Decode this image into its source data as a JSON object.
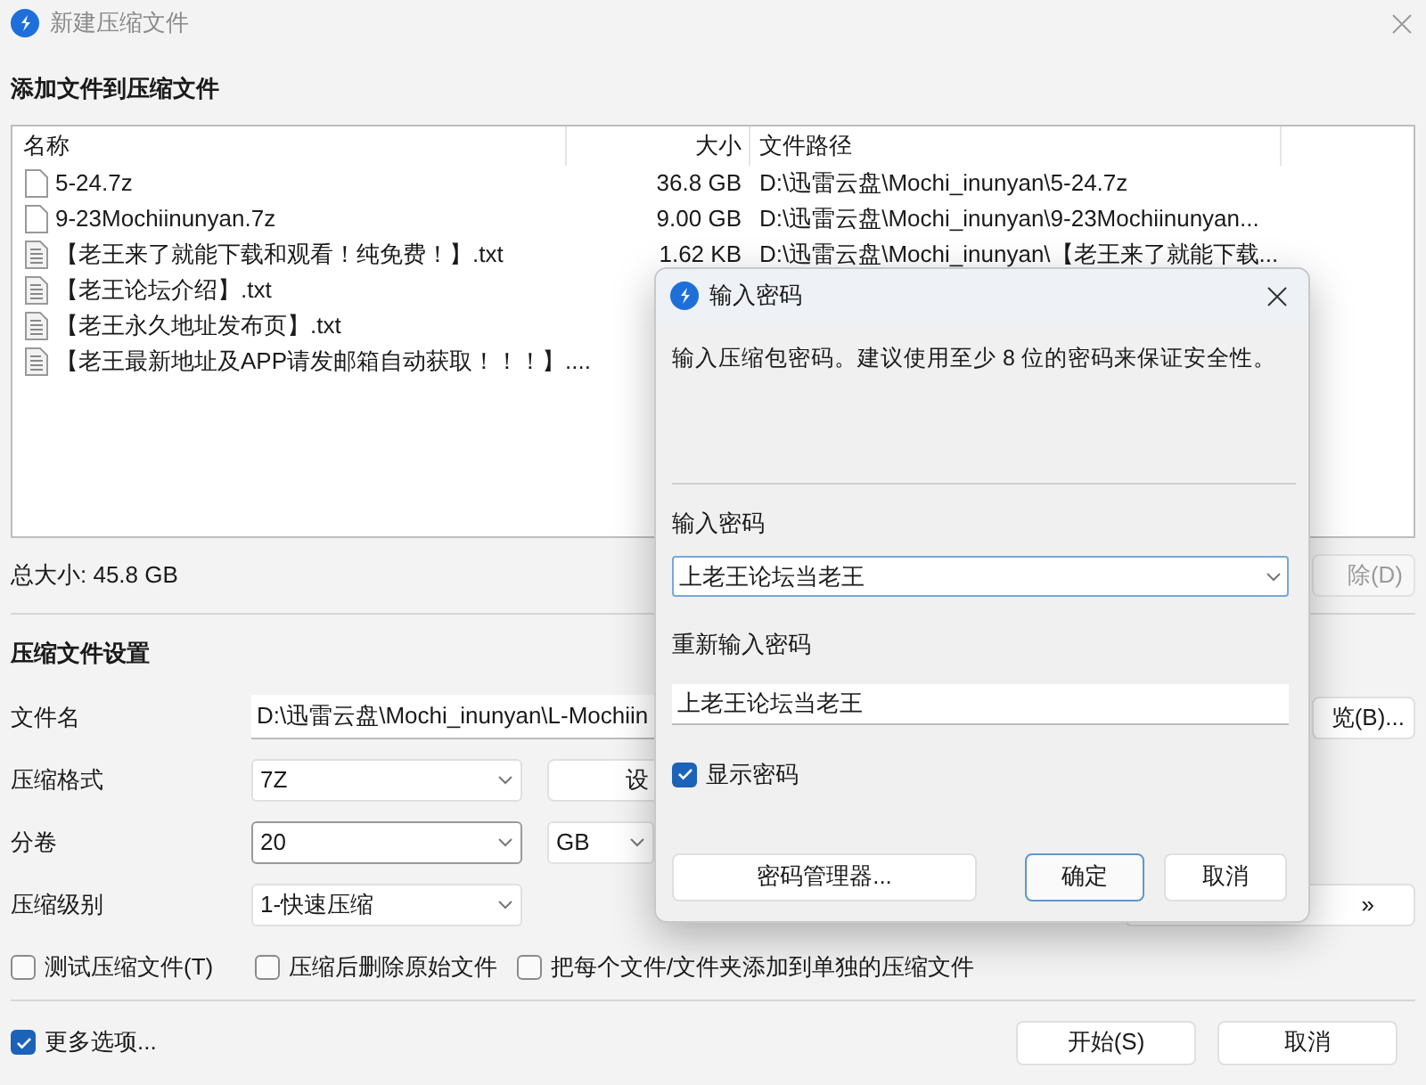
{
  "window": {
    "title": "新建压缩文件"
  },
  "files_section": {
    "heading": "添加文件到压缩文件",
    "columns": [
      "名称",
      "大小",
      "文件路径"
    ],
    "rows": [
      {
        "kind": "archive",
        "name": "5-24.7z",
        "size": "36.8 GB",
        "path": "D:\\迅雷云盘\\Mochi_inunyan\\5-24.7z"
      },
      {
        "kind": "archive",
        "name": "9-23Mochiinunyan.7z",
        "size": "9.00 GB",
        "path": "D:\\迅雷云盘\\Mochi_inunyan\\9-23Mochiinunyan..."
      },
      {
        "kind": "text",
        "name": "【老王来了就能下载和观看！纯免费！】.txt",
        "size": "1.62 KB",
        "path": "D:\\迅雷云盘\\Mochi_inunyan\\【老王来了就能下载..."
      },
      {
        "kind": "text",
        "name": "【老王论坛介绍】.txt"
      },
      {
        "kind": "text",
        "name": "【老王永久地址发布页】.txt"
      },
      {
        "kind": "text",
        "name": "【老王最新地址及APP请发邮箱自动获取！！！】...."
      }
    ],
    "total": "总大小: 45.8 GB",
    "delete_button": "除(D)"
  },
  "settings": {
    "heading": "压缩文件设置",
    "filename_label": "文件名",
    "filename_value": "D:\\迅雷云盘\\Mochi_inunyan\\L-Mochiin",
    "browse_button": "览(B)...",
    "format_label": "压缩格式",
    "format_value": "7Z",
    "format_settings_button": "设",
    "split_label": "分卷",
    "split_value": "20",
    "split_unit": "GB",
    "level_label": "压缩级别",
    "level_value": "1-快速压缩",
    "more_button": "»",
    "options": [
      {
        "label": "测试压缩文件(T)",
        "checked": false
      },
      {
        "label": "压缩后删除原始文件",
        "checked": false
      },
      {
        "label": "把每个文件/文件夹添加到单独的压缩文件",
        "checked": false
      }
    ]
  },
  "footer": {
    "more_options": {
      "label": "更多选项...",
      "checked": true
    },
    "buttons": [
      "开始(S)",
      "取消"
    ]
  },
  "password_dialog": {
    "title": "输入密码",
    "description": "输入压缩包密码。建议使用至少 8 位的密码来保证安全性。",
    "password_label": "输入密码",
    "password_value": "上老王论坛当老王",
    "confirm_label": "重新输入密码",
    "confirm_value": "上老王论坛当老王",
    "show_password": {
      "label": "显示密码",
      "checked": true
    },
    "manager_button": "密码管理器...",
    "ok_button": "确定",
    "cancel_button": "取消"
  }
}
